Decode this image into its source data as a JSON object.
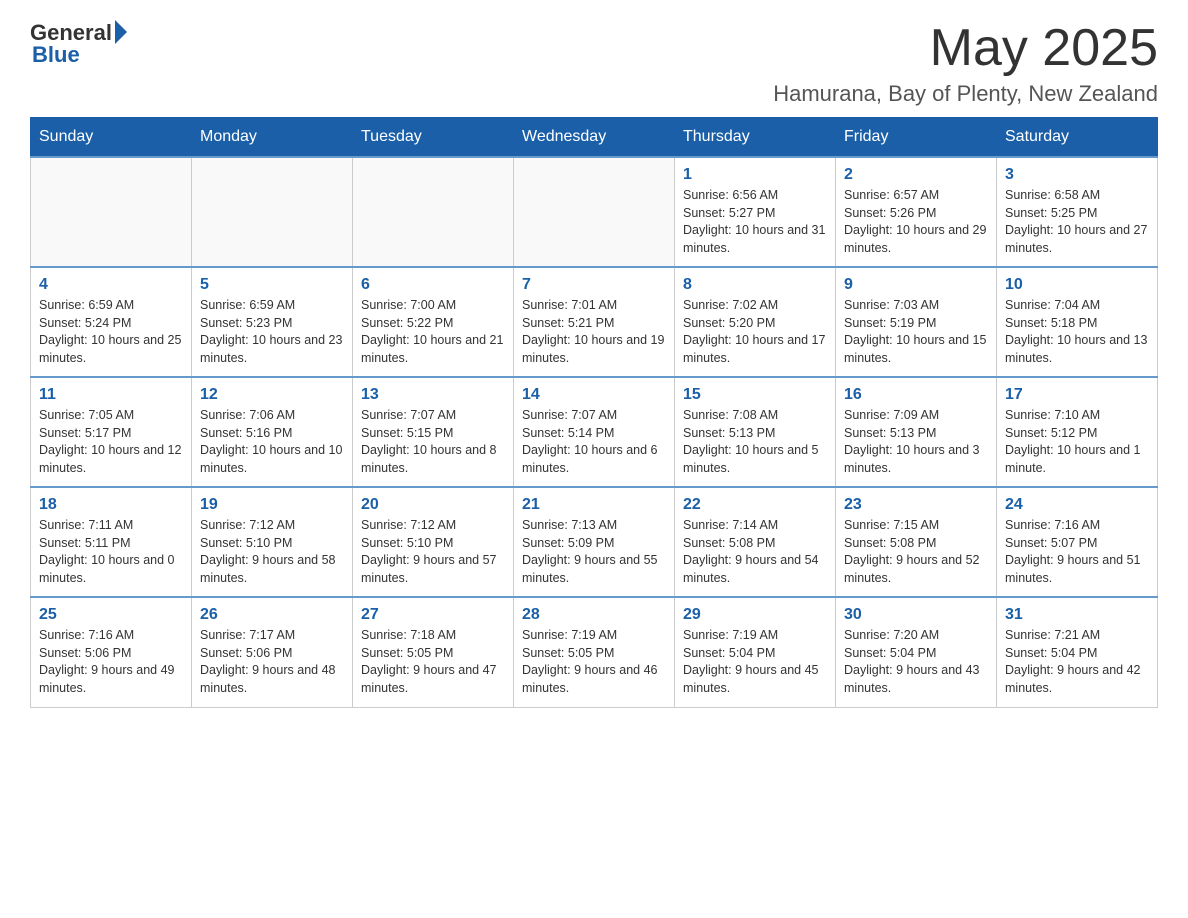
{
  "logo": {
    "general": "General",
    "blue": "Blue"
  },
  "header": {
    "month_year": "May 2025",
    "location": "Hamurana, Bay of Plenty, New Zealand"
  },
  "weekdays": [
    "Sunday",
    "Monday",
    "Tuesday",
    "Wednesday",
    "Thursday",
    "Friday",
    "Saturday"
  ],
  "weeks": [
    [
      {
        "day": "",
        "info": ""
      },
      {
        "day": "",
        "info": ""
      },
      {
        "day": "",
        "info": ""
      },
      {
        "day": "",
        "info": ""
      },
      {
        "day": "1",
        "info": "Sunrise: 6:56 AM\nSunset: 5:27 PM\nDaylight: 10 hours and 31 minutes."
      },
      {
        "day": "2",
        "info": "Sunrise: 6:57 AM\nSunset: 5:26 PM\nDaylight: 10 hours and 29 minutes."
      },
      {
        "day": "3",
        "info": "Sunrise: 6:58 AM\nSunset: 5:25 PM\nDaylight: 10 hours and 27 minutes."
      }
    ],
    [
      {
        "day": "4",
        "info": "Sunrise: 6:59 AM\nSunset: 5:24 PM\nDaylight: 10 hours and 25 minutes."
      },
      {
        "day": "5",
        "info": "Sunrise: 6:59 AM\nSunset: 5:23 PM\nDaylight: 10 hours and 23 minutes."
      },
      {
        "day": "6",
        "info": "Sunrise: 7:00 AM\nSunset: 5:22 PM\nDaylight: 10 hours and 21 minutes."
      },
      {
        "day": "7",
        "info": "Sunrise: 7:01 AM\nSunset: 5:21 PM\nDaylight: 10 hours and 19 minutes."
      },
      {
        "day": "8",
        "info": "Sunrise: 7:02 AM\nSunset: 5:20 PM\nDaylight: 10 hours and 17 minutes."
      },
      {
        "day": "9",
        "info": "Sunrise: 7:03 AM\nSunset: 5:19 PM\nDaylight: 10 hours and 15 minutes."
      },
      {
        "day": "10",
        "info": "Sunrise: 7:04 AM\nSunset: 5:18 PM\nDaylight: 10 hours and 13 minutes."
      }
    ],
    [
      {
        "day": "11",
        "info": "Sunrise: 7:05 AM\nSunset: 5:17 PM\nDaylight: 10 hours and 12 minutes."
      },
      {
        "day": "12",
        "info": "Sunrise: 7:06 AM\nSunset: 5:16 PM\nDaylight: 10 hours and 10 minutes."
      },
      {
        "day": "13",
        "info": "Sunrise: 7:07 AM\nSunset: 5:15 PM\nDaylight: 10 hours and 8 minutes."
      },
      {
        "day": "14",
        "info": "Sunrise: 7:07 AM\nSunset: 5:14 PM\nDaylight: 10 hours and 6 minutes."
      },
      {
        "day": "15",
        "info": "Sunrise: 7:08 AM\nSunset: 5:13 PM\nDaylight: 10 hours and 5 minutes."
      },
      {
        "day": "16",
        "info": "Sunrise: 7:09 AM\nSunset: 5:13 PM\nDaylight: 10 hours and 3 minutes."
      },
      {
        "day": "17",
        "info": "Sunrise: 7:10 AM\nSunset: 5:12 PM\nDaylight: 10 hours and 1 minute."
      }
    ],
    [
      {
        "day": "18",
        "info": "Sunrise: 7:11 AM\nSunset: 5:11 PM\nDaylight: 10 hours and 0 minutes."
      },
      {
        "day": "19",
        "info": "Sunrise: 7:12 AM\nSunset: 5:10 PM\nDaylight: 9 hours and 58 minutes."
      },
      {
        "day": "20",
        "info": "Sunrise: 7:12 AM\nSunset: 5:10 PM\nDaylight: 9 hours and 57 minutes."
      },
      {
        "day": "21",
        "info": "Sunrise: 7:13 AM\nSunset: 5:09 PM\nDaylight: 9 hours and 55 minutes."
      },
      {
        "day": "22",
        "info": "Sunrise: 7:14 AM\nSunset: 5:08 PM\nDaylight: 9 hours and 54 minutes."
      },
      {
        "day": "23",
        "info": "Sunrise: 7:15 AM\nSunset: 5:08 PM\nDaylight: 9 hours and 52 minutes."
      },
      {
        "day": "24",
        "info": "Sunrise: 7:16 AM\nSunset: 5:07 PM\nDaylight: 9 hours and 51 minutes."
      }
    ],
    [
      {
        "day": "25",
        "info": "Sunrise: 7:16 AM\nSunset: 5:06 PM\nDaylight: 9 hours and 49 minutes."
      },
      {
        "day": "26",
        "info": "Sunrise: 7:17 AM\nSunset: 5:06 PM\nDaylight: 9 hours and 48 minutes."
      },
      {
        "day": "27",
        "info": "Sunrise: 7:18 AM\nSunset: 5:05 PM\nDaylight: 9 hours and 47 minutes."
      },
      {
        "day": "28",
        "info": "Sunrise: 7:19 AM\nSunset: 5:05 PM\nDaylight: 9 hours and 46 minutes."
      },
      {
        "day": "29",
        "info": "Sunrise: 7:19 AM\nSunset: 5:04 PM\nDaylight: 9 hours and 45 minutes."
      },
      {
        "day": "30",
        "info": "Sunrise: 7:20 AM\nSunset: 5:04 PM\nDaylight: 9 hours and 43 minutes."
      },
      {
        "day": "31",
        "info": "Sunrise: 7:21 AM\nSunset: 5:04 PM\nDaylight: 9 hours and 42 minutes."
      }
    ]
  ]
}
